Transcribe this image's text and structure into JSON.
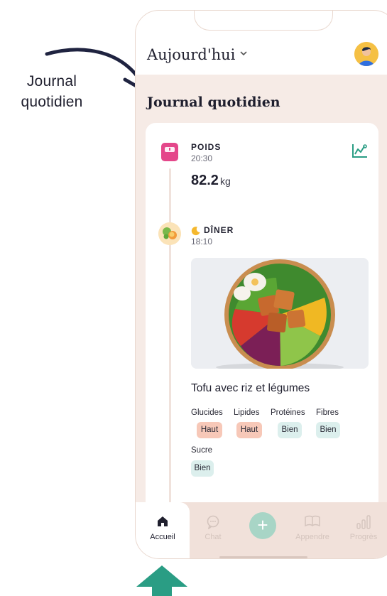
{
  "annotation": {
    "line1": "Journal",
    "line2": "quotidien"
  },
  "header": {
    "title": "Aujourd'hui"
  },
  "journal": {
    "section_title": "Journal quotidien",
    "weight": {
      "label": "POIDS",
      "time": "20:30",
      "value": "82.2",
      "unit": "kg"
    },
    "meal": {
      "label": "DÎNER",
      "time": "18:10",
      "name": "Tofu avec riz et légumes",
      "nutrients": [
        {
          "name": "Glucides",
          "rating": "Haut"
        },
        {
          "name": "Lipides",
          "rating": "Haut"
        },
        {
          "name": "Protéines",
          "rating": "Bien"
        },
        {
          "name": "Fibres",
          "rating": "Bien"
        },
        {
          "name": "Sucre",
          "rating": "Bien"
        }
      ]
    }
  },
  "bottom_nav": {
    "items": [
      {
        "label": "Accueil"
      },
      {
        "label": "Chat"
      },
      {
        "label": "Appendre"
      },
      {
        "label": "Progrès"
      }
    ]
  },
  "colors": {
    "accent": "#2a9d84",
    "background": "#f6ebe6",
    "rating_high": "#f7c8b8",
    "rating_good": "#dcefed"
  }
}
